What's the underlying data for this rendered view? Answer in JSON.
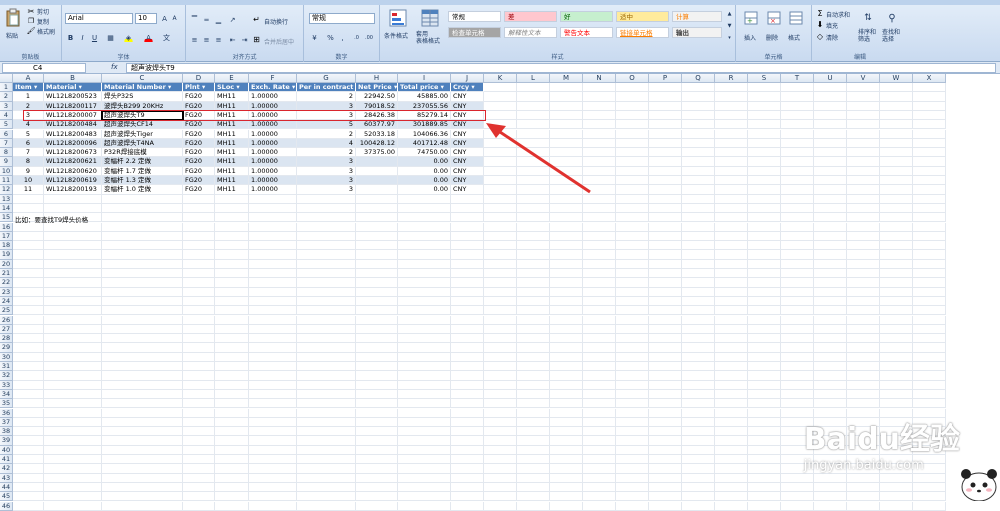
{
  "ribbon": {
    "clipboard": {
      "paste": "粘贴",
      "cut": "剪切",
      "copy": "复制",
      "format_painter": "格式刷",
      "label": "剪贴板"
    },
    "font": {
      "name": "Arial",
      "size": "10",
      "label": "字体"
    },
    "alignment": {
      "wrap": "自动换行",
      "merge": "合并后居中",
      "label": "对齐方式"
    },
    "number": {
      "format": "常规",
      "label": "数字"
    },
    "styles": {
      "conditional": "条件格式",
      "table_format": "套用\n表格格式",
      "label": "样式",
      "cells": [
        {
          "text": "常规",
          "bg": "#ffffff",
          "color": "#000000"
        },
        {
          "text": "差",
          "bg": "#ffc7ce",
          "color": "#9c0006"
        },
        {
          "text": "好",
          "bg": "#c6efce",
          "color": "#006100"
        },
        {
          "text": "适中",
          "bg": "#ffeb9c",
          "color": "#9c6500"
        },
        {
          "text": "计算",
          "bg": "#f2f2f2",
          "color": "#fa7d00"
        },
        {
          "text": "检查单元格",
          "bg": "#a5a5a5",
          "color": "#ffffff"
        },
        {
          "text": "解释性文本",
          "bg": "#ffffff",
          "color": "#7f7f7f"
        },
        {
          "text": "警告文本",
          "bg": "#ffffff",
          "color": "#ff0000"
        },
        {
          "text": "链接单元格",
          "bg": "#ffffff",
          "color": "#fa7d00"
        },
        {
          "text": "输出",
          "bg": "#f2f2f2",
          "color": "#3f3f3f"
        }
      ]
    },
    "cells_group": {
      "insert": "插入",
      "delete": "删除",
      "format": "格式",
      "label": "单元格"
    },
    "editing": {
      "autosum": "自动求和",
      "fill": "填充",
      "clear": "清除",
      "sort": "排序和\n筛选",
      "find": "查找和\n选择",
      "label": "编辑"
    }
  },
  "formula_bar": {
    "name_box": "C4",
    "fx": "fx",
    "content": "超声波焊头T9"
  },
  "columns": [
    "A",
    "B",
    "C",
    "D",
    "E",
    "F",
    "G",
    "H",
    "I",
    "J",
    "K",
    "L",
    "M",
    "N",
    "O",
    "P",
    "Q",
    "R",
    "S",
    "T",
    "U",
    "V",
    "W",
    "X"
  ],
  "table": {
    "headers": [
      "Item",
      "Material",
      "Material Number",
      "Plnt",
      "SLoc",
      "Exch. Rate",
      "Per in contract",
      "Net Price",
      "Total price",
      "Crcy"
    ],
    "rows": [
      [
        "1",
        "WL12L8200523",
        "焊头P32S",
        "FG20",
        "MH11",
        "1.00000",
        "2",
        "22942.50",
        "45885.00",
        "CNY"
      ],
      [
        "2",
        "WL12L8200117",
        "波焊头B299 20KHz",
        "FG20",
        "MH11",
        "1.00000",
        "3",
        "79018.52",
        "237055.56",
        "CNY"
      ],
      [
        "3",
        "WL12L8200007",
        "超声波焊头T9",
        "FG20",
        "MH11",
        "1.00000",
        "3",
        "28426.38",
        "85279.14",
        "CNY"
      ],
      [
        "4",
        "WL12L8200484",
        "超声波焊头CF14",
        "FG20",
        "MH11",
        "1.00000",
        "5",
        "60377.97",
        "301889.85",
        "CNY"
      ],
      [
        "5",
        "WL12L8200483",
        "超声波焊头Tiger",
        "FG20",
        "MH11",
        "1.00000",
        "2",
        "52033.18",
        "104066.36",
        "CNY"
      ],
      [
        "6",
        "WL12L8200096",
        "超声波焊头T4NA",
        "FG20",
        "MH11",
        "1.00000",
        "4",
        "100428.12",
        "401712.48",
        "CNY"
      ],
      [
        "7",
        "WL12L8200673",
        "P32R焊接底模",
        "FG20",
        "MH11",
        "1.00000",
        "2",
        "37375.00",
        "74750.00",
        "CNY"
      ],
      [
        "8",
        "WL12L8200621",
        "变幅杆 2.2 定做",
        "FG20",
        "MH11",
        "1.00000",
        "3",
        "",
        "0.00",
        "CNY"
      ],
      [
        "9",
        "WL12L8200620",
        "变幅杆 1.7 定做",
        "FG20",
        "MH11",
        "1.00000",
        "3",
        "",
        "0.00",
        "CNY"
      ],
      [
        "10",
        "WL12L8200619",
        "变幅杆 1.3 定做",
        "FG20",
        "MH11",
        "1.00000",
        "3",
        "",
        "0.00",
        "CNY"
      ],
      [
        "11",
        "WL12L8200193",
        "变幅杆 1.0 定做",
        "FG20",
        "MH11",
        "1.00000",
        "3",
        "",
        "0.00",
        "CNY"
      ]
    ]
  },
  "note": "比如：要查找T9焊头价格",
  "watermark": {
    "logo": "Baidu经验",
    "url": "jingyan.baidu.com"
  },
  "row_count": 46
}
